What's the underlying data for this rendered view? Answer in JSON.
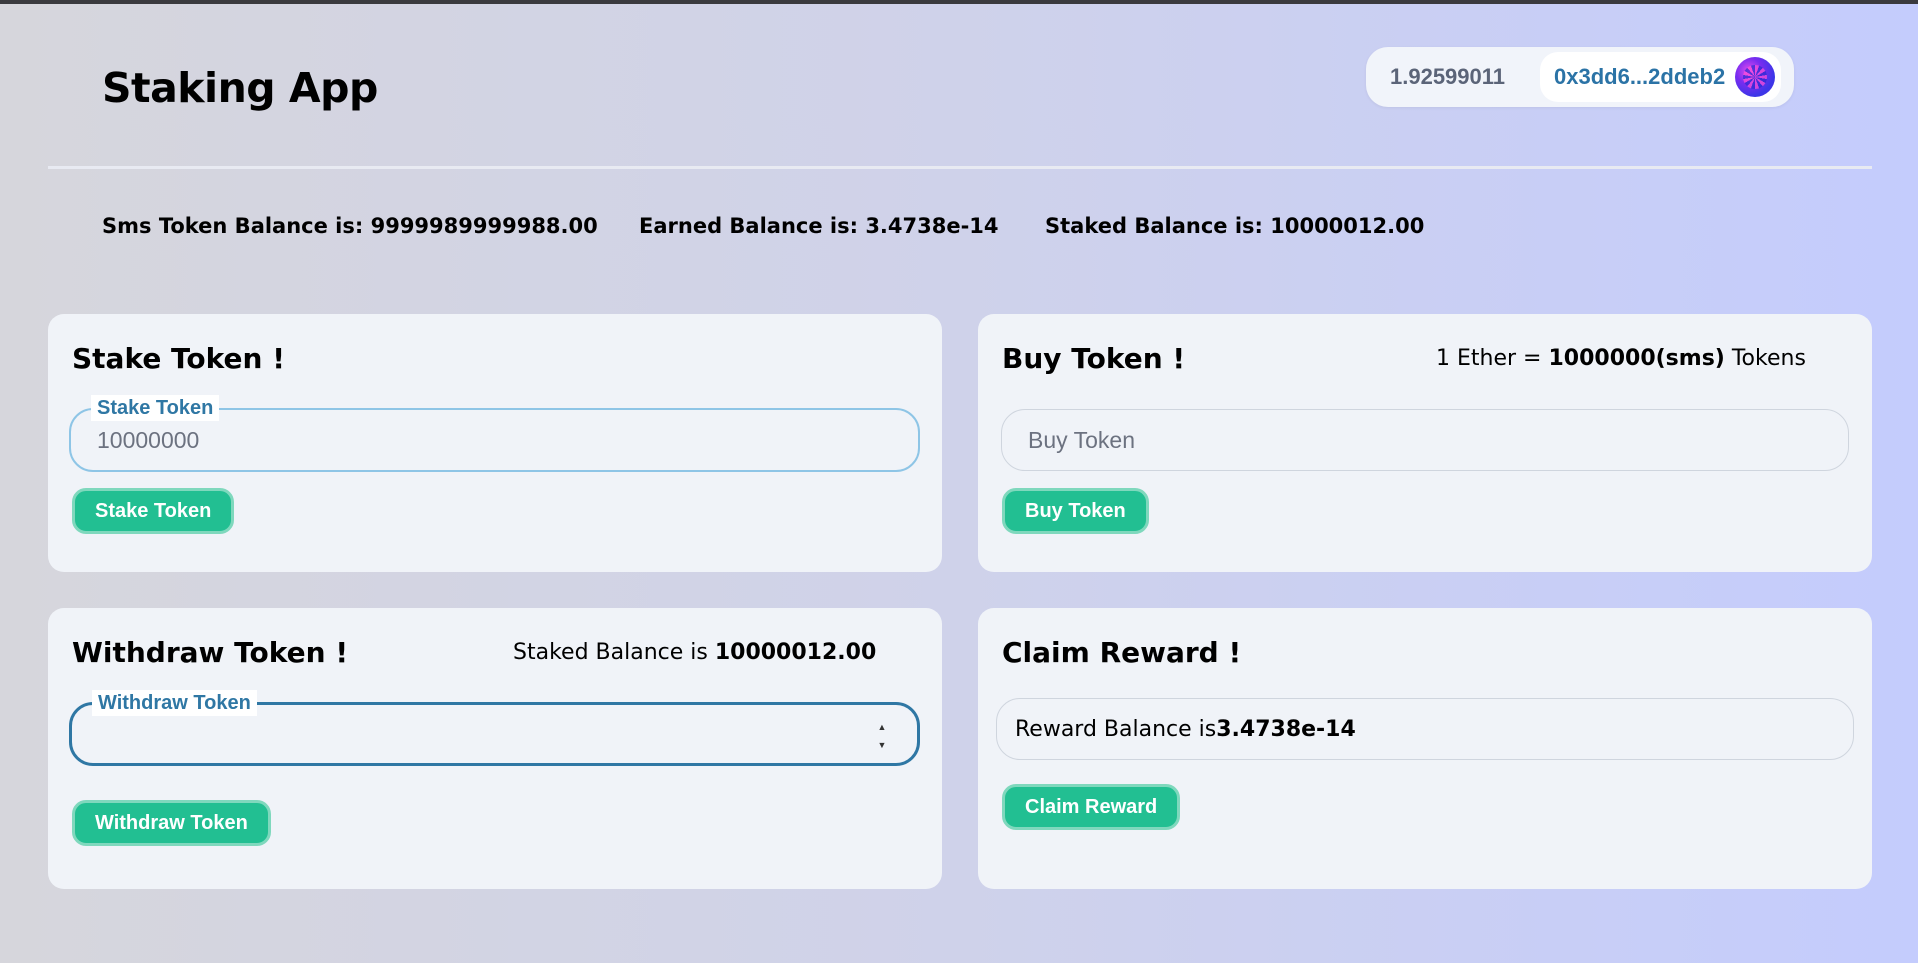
{
  "header": {
    "app_title": "Staking App",
    "wallet_balance": "1.92599011",
    "wallet_address": "0x3dd6...2ddeb2"
  },
  "stats": {
    "sms_balance": "Sms Token Balance is: 9999989999988.00",
    "earned_balance": "Earned Balance is: 3.4738e-14",
    "staked_balance": "Staked Balance is: 10000012.00"
  },
  "stake_card": {
    "title": "Stake Token !",
    "field_label": "Stake Token",
    "input_value": "10000000",
    "button_label": "Stake Token"
  },
  "buy_card": {
    "title": "Buy Token !",
    "rate_prefix": "1 Ether = ",
    "rate_value": "1000000(sms)",
    "rate_suffix": " Tokens",
    "input_placeholder": "Buy Token",
    "button_label": "Buy Token"
  },
  "withdraw_card": {
    "title": "Withdraw Token !",
    "staked_prefix": "Staked Balance is ",
    "staked_value": "10000012.00",
    "field_label": "Withdraw Token",
    "input_value": "",
    "button_label": "Withdraw Token"
  },
  "claim_card": {
    "title": "Claim Reward !",
    "reward_prefix": "Reward Balance is ",
    "reward_value": "3.4738e-14",
    "button_label": "Claim Reward"
  },
  "colors": {
    "accent_button": "#22bf92",
    "field_label": "#2f77a4",
    "wallet_address": "#2b73a6"
  }
}
